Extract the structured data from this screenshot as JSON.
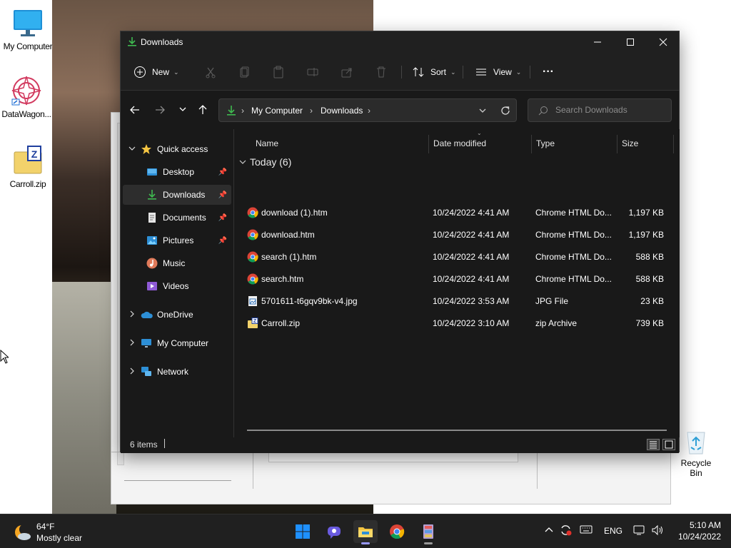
{
  "desktop": {
    "icons": [
      {
        "label": "My Computer"
      },
      {
        "label": "DataWagon..."
      },
      {
        "label": "Carroll.zip"
      },
      {
        "label": "Recycle Bin"
      }
    ]
  },
  "explorer": {
    "title": "Downloads",
    "toolbar": {
      "new_label": "New",
      "sort_label": "Sort",
      "view_label": "View",
      "more_label": "···"
    },
    "breadcrumb": [
      "My Computer",
      "Downloads"
    ],
    "search_placeholder": "Search Downloads",
    "nav": {
      "quick_access": "Quick access",
      "items": [
        {
          "label": "Desktop",
          "pinned": true
        },
        {
          "label": "Downloads",
          "pinned": true,
          "selected": true
        },
        {
          "label": "Documents",
          "pinned": true
        },
        {
          "label": "Pictures",
          "pinned": true
        },
        {
          "label": "Music",
          "pinned": false
        },
        {
          "label": "Videos",
          "pinned": false
        }
      ],
      "roots": [
        "OneDrive",
        "My Computer",
        "Network"
      ]
    },
    "columns": [
      "Name",
      "Date modified",
      "Type",
      "Size"
    ],
    "group": "Today (6)",
    "files": [
      {
        "name": "download (1).htm",
        "date": "10/24/2022 4:41 AM",
        "type": "Chrome HTML Do...",
        "size": "1,197 KB",
        "icon": "chrome-icon"
      },
      {
        "name": "download.htm",
        "date": "10/24/2022 4:41 AM",
        "type": "Chrome HTML Do...",
        "size": "1,197 KB",
        "icon": "chrome-icon"
      },
      {
        "name": "search (1).htm",
        "date": "10/24/2022 4:41 AM",
        "type": "Chrome HTML Do...",
        "size": "588 KB",
        "icon": "chrome-icon"
      },
      {
        "name": "search.htm",
        "date": "10/24/2022 4:41 AM",
        "type": "Chrome HTML Do...",
        "size": "588 KB",
        "icon": "chrome-icon"
      },
      {
        "name": "5701611-t6gqv9bk-v4.jpg",
        "date": "10/24/2022 3:53 AM",
        "type": "JPG File",
        "size": "23 KB",
        "icon": "image-file-icon"
      },
      {
        "name": "Carroll.zip",
        "date": "10/24/2022 3:10 AM",
        "type": "zip Archive",
        "size": "739 KB",
        "icon": "zip-file-icon"
      }
    ],
    "status": "6 items"
  },
  "taskbar": {
    "weather_temp": "64°F",
    "weather_desc": "Mostly clear",
    "lang": "ENG",
    "time": "5:10 AM",
    "date": "10/24/2022"
  },
  "colors": {
    "accent_green": "#3fb950",
    "folder_yellow": "#f4c542",
    "win_blue": "#1e90ff"
  }
}
